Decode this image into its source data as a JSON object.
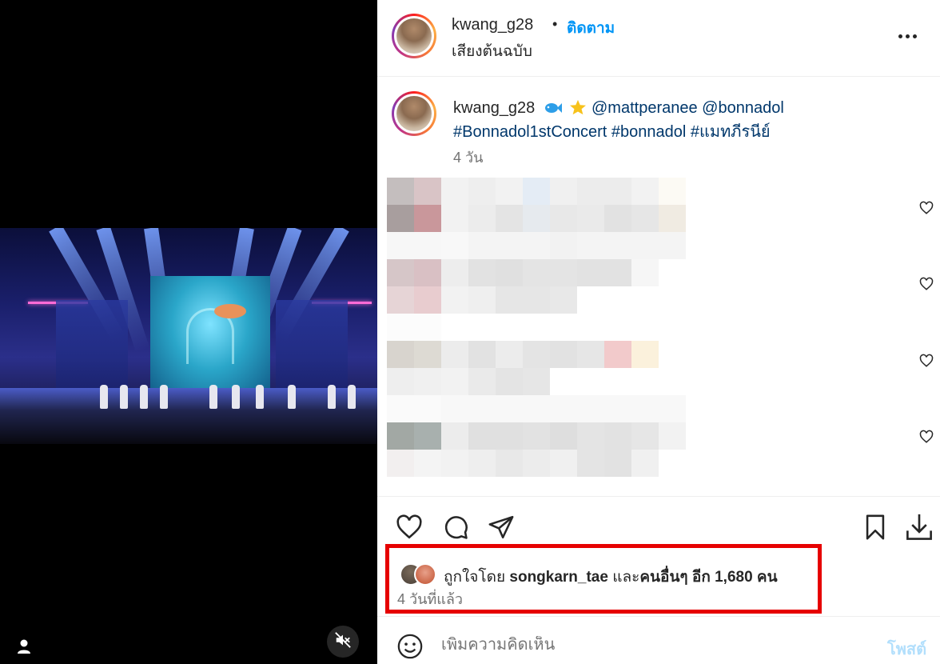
{
  "media": {
    "user_icon": "user-icon",
    "mute_icon": "speaker-muted-icon"
  },
  "header": {
    "username": "kwang_g28",
    "dot": "•",
    "follow_label": "ติดตาม",
    "audio_label": "เสียงต้นฉบับ",
    "more_icon": "more-horizontal-icon"
  },
  "caption": {
    "username": "kwang_g28",
    "mention1": "@mattperanee",
    "mention2": "@bonnadol",
    "hashtag1": "#Bonnadol1stConcert",
    "hashtag2": "#bonnadol",
    "hashtag3": "#แมทภีรนีย์",
    "time": "4 วัน"
  },
  "comments_colors": {
    "row1": [
      "#c4bebe",
      "#d9c4c6",
      "#f2f2f2",
      "#eeeeee",
      "#f2f2f2",
      "#e4ecf5",
      "#f0f0f0",
      "#ececec",
      "#ececec",
      "#f2f2f2",
      "#fcfaf4"
    ],
    "row2": [
      "#a89e9e",
      "#c9979b",
      "#f2f2f2",
      "#ececec",
      "#e4e4e4",
      "#e6eaee",
      "#e8e8e8",
      "#eaeaea",
      "#e2e2e2",
      "#e6e6e6",
      "#f0ebe2"
    ],
    "row3": [
      "#f7f7f7",
      "#f7f7f7",
      "#f8f8f8",
      "#f4f4f4",
      "#f4f4f4",
      "#f4f4f4",
      "#f2f2f2",
      "#f4f4f4",
      "#f4f4f4",
      "#f4f4f4",
      "#f4f4f4"
    ],
    "row4": [
      "#d6c6c8",
      "#d9c0c4",
      "#ededed",
      "#e2e2e2",
      "#e0e0e0",
      "#e4e4e4",
      "#e4e4e4",
      "#e2e2e2",
      "#e2e2e2",
      "#f6f6f6",
      "#ffffff"
    ],
    "row5": [
      "#e6d4d6",
      "#e8cccf",
      "#f2f2f2",
      "#efefef",
      "#e6e6e6",
      "#e6e6e6",
      "#e8e8e8",
      "#ffffff",
      "#ffffff",
      "#ffffff",
      "#ffffff"
    ],
    "row6": [
      "#fcfcfc",
      "#fcfcfc",
      "#ffffff",
      "#ffffff",
      "#ffffff",
      "#ffffff",
      "#ffffff",
      "#ffffff",
      "#ffffff",
      "#ffffff",
      "#ffffff"
    ],
    "row7": [
      "#d8d4ce",
      "#dddad3",
      "#ececec",
      "#e2e2e2",
      "#ececec",
      "#e4e4e4",
      "#e2e2e2",
      "#e6e6e6",
      "#f2cacb",
      "#fbf1dc",
      "#ffffff"
    ],
    "row8": [
      "#eeeeee",
      "#f0f0f0",
      "#f2f2f2",
      "#eaeaea",
      "#e4e4e4",
      "#e6e6e6",
      "#ffffff",
      "#ffffff",
      "#ffffff",
      "#ffffff",
      "#ffffff"
    ],
    "row9": [
      "#fafafa",
      "#fafafa",
      "#f8f8f8",
      "#f8f8f8",
      "#f8f8f8",
      "#f8f8f8",
      "#f8f8f8",
      "#f8f8f8",
      "#f8f8f8",
      "#f8f8f8",
      "#f8f8f8"
    ],
    "row10": [
      "#a2a8a4",
      "#a8b0ae",
      "#ececec",
      "#e0e0e0",
      "#e0e0e0",
      "#e2e2e2",
      "#dedede",
      "#e4e4e4",
      "#e2e2e2",
      "#e6e6e6",
      "#f2f2f2"
    ],
    "row11": [
      "#f2efef",
      "#f4f4f4",
      "#f2f2f2",
      "#eeeeee",
      "#e8e8e8",
      "#ececec",
      "#f0f0f0",
      "#e4e4e4",
      "#e2e2e2",
      "#f0f0f0",
      "#ffffff"
    ]
  },
  "actions": {
    "like_icon": "heart-icon",
    "comment_icon": "comment-icon",
    "share_icon": "send-icon",
    "save_icon": "bookmark-icon",
    "download_icon": "download-icon"
  },
  "likes": {
    "prefix": "ถูกใจโดย",
    "user": "songkarn_tae",
    "middle": "และ",
    "others": "คนอื่นๆ อีก 1,680 คน",
    "time": "4 วันที่แล้ว"
  },
  "comment_bar": {
    "emoji_icon": "smiley-icon",
    "placeholder": "เพิ่มความคิดเห็น",
    "post_label": "โพสต์"
  },
  "colors": {
    "accent": "#0095f6",
    "highlight_border": "#e60000",
    "post_disabled": "#b2dffc"
  }
}
